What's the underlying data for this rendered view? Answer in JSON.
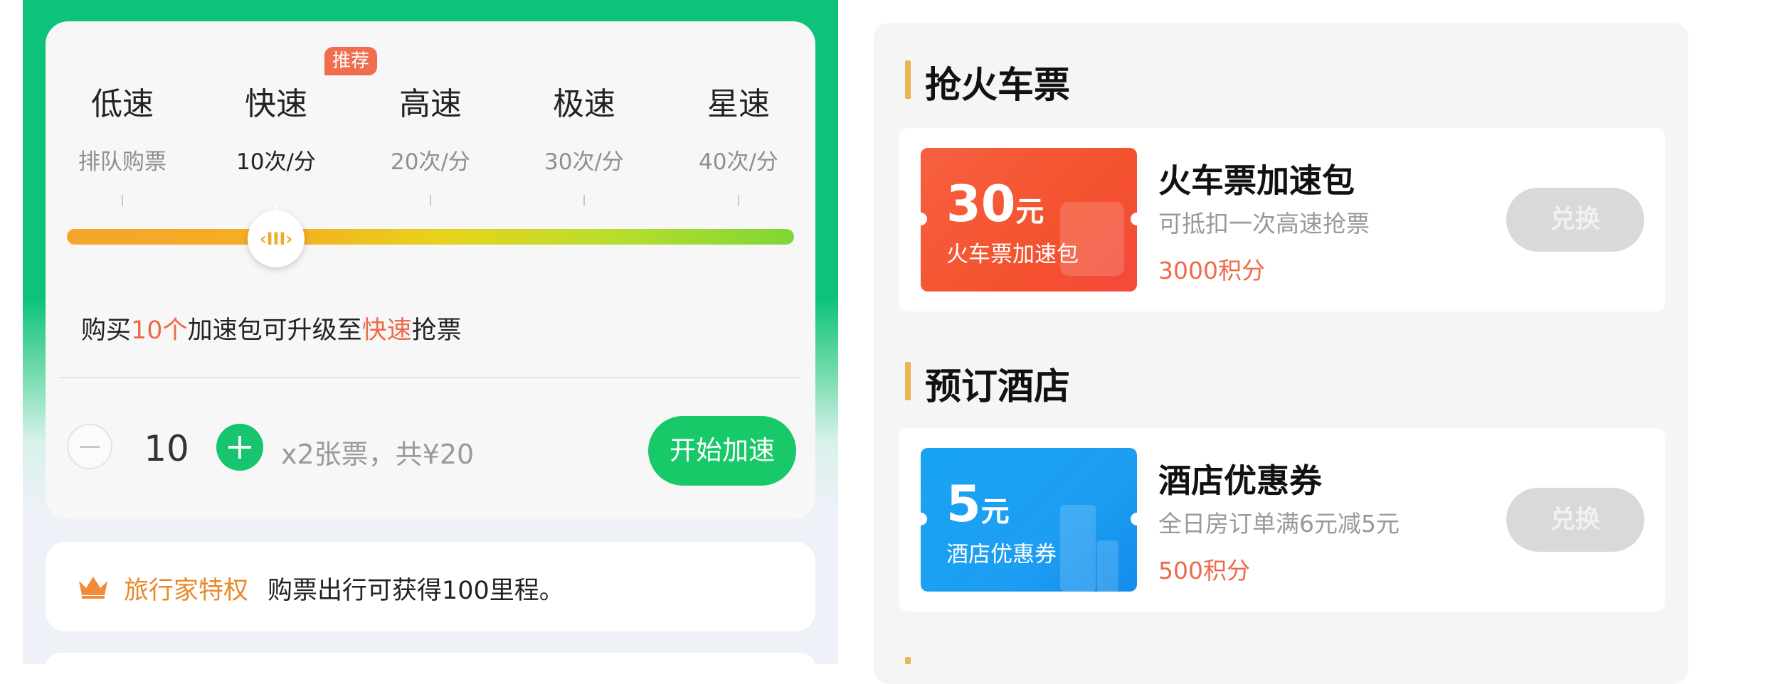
{
  "speed_selector": {
    "badge": "推荐",
    "levels": [
      {
        "name": "低速",
        "rate": "排队购票"
      },
      {
        "name": "快速",
        "rate": "10次/分"
      },
      {
        "name": "高速",
        "rate": "20次/分"
      },
      {
        "name": "极速",
        "rate": "30次/分"
      },
      {
        "name": "星速",
        "rate": "40次/分"
      }
    ],
    "selected_index": 1,
    "slider_thumb": "‹III›",
    "slider_colors": [
      "#f5a52c",
      "#e7d31c",
      "#7fd635"
    ]
  },
  "upgrade_hint": {
    "prefix": "购买",
    "count": "10个",
    "middle": "加速包可升级至",
    "level": "快速",
    "suffix": "抢票"
  },
  "purchase": {
    "quantity": "10",
    "price_text": "x2张票，共¥20",
    "start_label": "开始加速"
  },
  "privilege": {
    "icon": "crown-icon",
    "title": "旅行家特权",
    "text": "购票出行可获得100里程。"
  },
  "sections": [
    {
      "title": "抢火车票",
      "product": {
        "coupon_amount": "30",
        "coupon_unit": "元",
        "coupon_name": "火车票加速包",
        "title": "火车票加速包",
        "desc": "可抵扣一次高速抢票",
        "points": "3000积分",
        "button": "兑换"
      }
    },
    {
      "title": "预订酒店",
      "product": {
        "coupon_amount": "5",
        "coupon_unit": "元",
        "coupon_name": "酒店优惠券",
        "title": "酒店优惠券",
        "desc": "全日房订单满6元减5元",
        "points": "500积分",
        "button": "兑换"
      }
    }
  ],
  "colors": {
    "brand_green": "#0dc37b",
    "accent_orange": "#ef6a4a",
    "section_bar": "#e9b451",
    "coupon_red": "#f4522f",
    "coupon_blue": "#1d9ef3"
  }
}
